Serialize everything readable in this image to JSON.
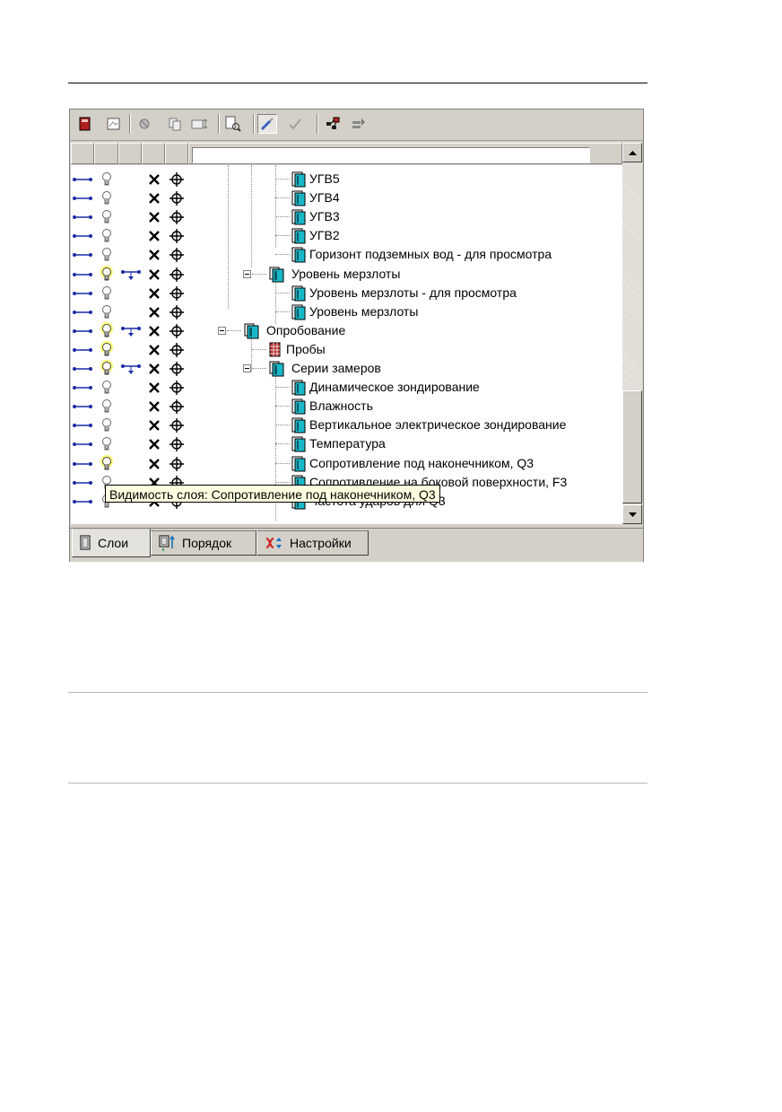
{
  "toolbar": {
    "buttons": [
      {
        "icon": "layer-properties-icon"
      },
      {
        "icon": "layer-image-icon"
      },
      {
        "icon": "move-icon"
      },
      {
        "icon": "copy-icon"
      },
      {
        "icon": "resize-icon"
      },
      {
        "icon": "layer-find-icon"
      },
      {
        "icon": "brush-icon",
        "pressed": true
      },
      {
        "icon": "check-icon"
      },
      {
        "icon": "network-icon"
      },
      {
        "icon": "layers-edit-icon"
      }
    ]
  },
  "column_headers": [
    "",
    "",
    "",
    "",
    ""
  ],
  "name_filter_value": "",
  "tree_rows": [
    {
      "label": "УГВ5",
      "level": 3,
      "icon": "layer-icon",
      "bulb_active": false,
      "link": false
    },
    {
      "label": "УГВ4",
      "level": 3,
      "icon": "layer-icon",
      "bulb_active": false,
      "link": false
    },
    {
      "label": "УГВ3",
      "level": 3,
      "icon": "layer-icon",
      "bulb_active": false,
      "link": false
    },
    {
      "label": "УГВ2",
      "level": 3,
      "icon": "layer-icon",
      "bulb_active": false,
      "link": false
    },
    {
      "label": "Горизонт подземных вод - для просмотра",
      "level": 3,
      "icon": "layer-icon",
      "bulb_active": false,
      "link": false
    },
    {
      "label": "Уровень мерзлоты",
      "level": 2,
      "icon": "group-icon",
      "bulb_active": true,
      "link": true,
      "expanded": true
    },
    {
      "label": "Уровень мерзлоты - для просмотра",
      "level": 3,
      "icon": "layer-icon",
      "bulb_active": false,
      "link": false
    },
    {
      "label": "Уровень мерзлоты",
      "level": 3,
      "icon": "layer-icon",
      "bulb_active": false,
      "link": false
    },
    {
      "label": "Опробование",
      "level": 1,
      "icon": "group-icon",
      "bulb_active": true,
      "link": true,
      "expanded": true
    },
    {
      "label": "Пробы",
      "level": 2,
      "icon": "samples-icon",
      "bulb_active": true,
      "link": false
    },
    {
      "label": "Серии замеров",
      "level": 2,
      "icon": "group-icon",
      "bulb_active": true,
      "link": true,
      "expanded": true
    },
    {
      "label": "Динамическое зондирование",
      "level": 3,
      "icon": "layer-icon",
      "bulb_active": false,
      "link": false
    },
    {
      "label": "Влажность",
      "level": 3,
      "icon": "layer-icon",
      "bulb_active": false,
      "link": false
    },
    {
      "label": "Вертикальное электрическое зондирование",
      "level": 3,
      "icon": "layer-icon",
      "bulb_active": false,
      "link": false
    },
    {
      "label": "Температура",
      "level": 3,
      "icon": "layer-icon",
      "bulb_active": false,
      "link": false
    },
    {
      "label": "Сопротивление под наконечником, Q3",
      "level": 3,
      "icon": "layer-icon",
      "bulb_active": true,
      "link": false
    },
    {
      "label": "Сопротивление на боковой поверхности, F3",
      "level": 3,
      "icon": "layer-icon",
      "bulb_active": false,
      "link": false
    },
    {
      "label": "Частота ударов для Q3",
      "level": 3,
      "icon": "layer-icon",
      "bulb_active": false,
      "link": false
    }
  ],
  "tooltip": "Видимость слоя: Сопротивление под наконечником, Q3",
  "tabs": [
    {
      "label": "Слои",
      "icon": "layers-tab-icon",
      "active": true
    },
    {
      "label": "Порядок",
      "icon": "order-tab-icon",
      "active": false
    },
    {
      "label": "Настройки",
      "icon": "settings-tab-icon",
      "active": false
    }
  ],
  "colors": {
    "panel_bg": "#d4d0c8",
    "tooltip_bg": "#ffffe1",
    "layer_icon": "#19b8c8",
    "link_blue": "#1a2aa8",
    "bulb_active": "#ffff00"
  }
}
